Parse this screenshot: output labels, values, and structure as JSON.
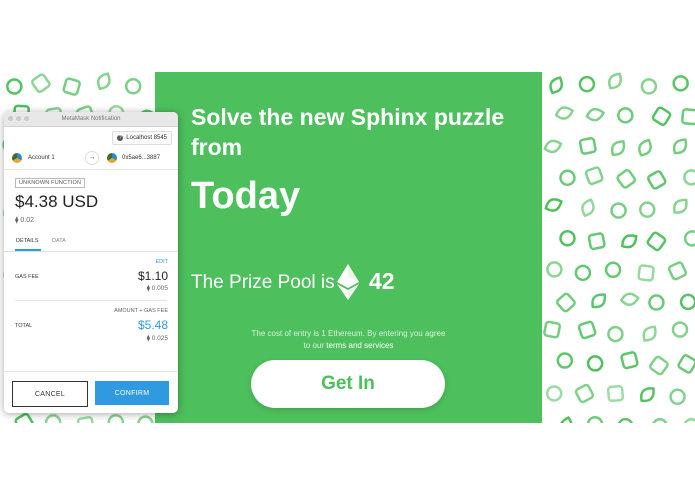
{
  "hero": {
    "title": "Solve the new Sphinx puzzle from",
    "subtitle": "Today",
    "prize_label": "The Prize Pool is",
    "prize_amount": "42",
    "fine_print_line1": "The cost of entry is 1 Ethereum. By entering you agree",
    "fine_print_prefix": "to our",
    "fine_print_link": "terms and services",
    "button_label": "Get In",
    "colors": {
      "background": "#4dbf5c",
      "pattern": "#4dbf5c"
    }
  },
  "metamask": {
    "window_title": "MetaMask Notification",
    "network": "Localhost 8545",
    "from_account": "Account 1",
    "to_address": "0x5ae6...3887",
    "function_badge": "UNKNOWN FUNCTION",
    "amount_usd": "$4.38 USD",
    "amount_eth": "0.02",
    "tabs": [
      "DETAILS",
      "DATA"
    ],
    "edit_label": "EDIT",
    "gas_fee_label": "GAS FEE",
    "gas_fee_usd": "$1.10",
    "gas_fee_eth": "0.005",
    "amount_plus_gas_label": "AMOUNT + GAS FEE",
    "total_label": "TOTAL",
    "total_usd": "$5.48",
    "total_eth": "0.025",
    "cancel_label": "CANCEL",
    "confirm_label": "CONFIRM",
    "accent_color": "#2f9ae0"
  },
  "icons": [
    "ethereum-icon",
    "question-icon",
    "arrow-right-icon",
    "account-avatar-icon"
  ]
}
